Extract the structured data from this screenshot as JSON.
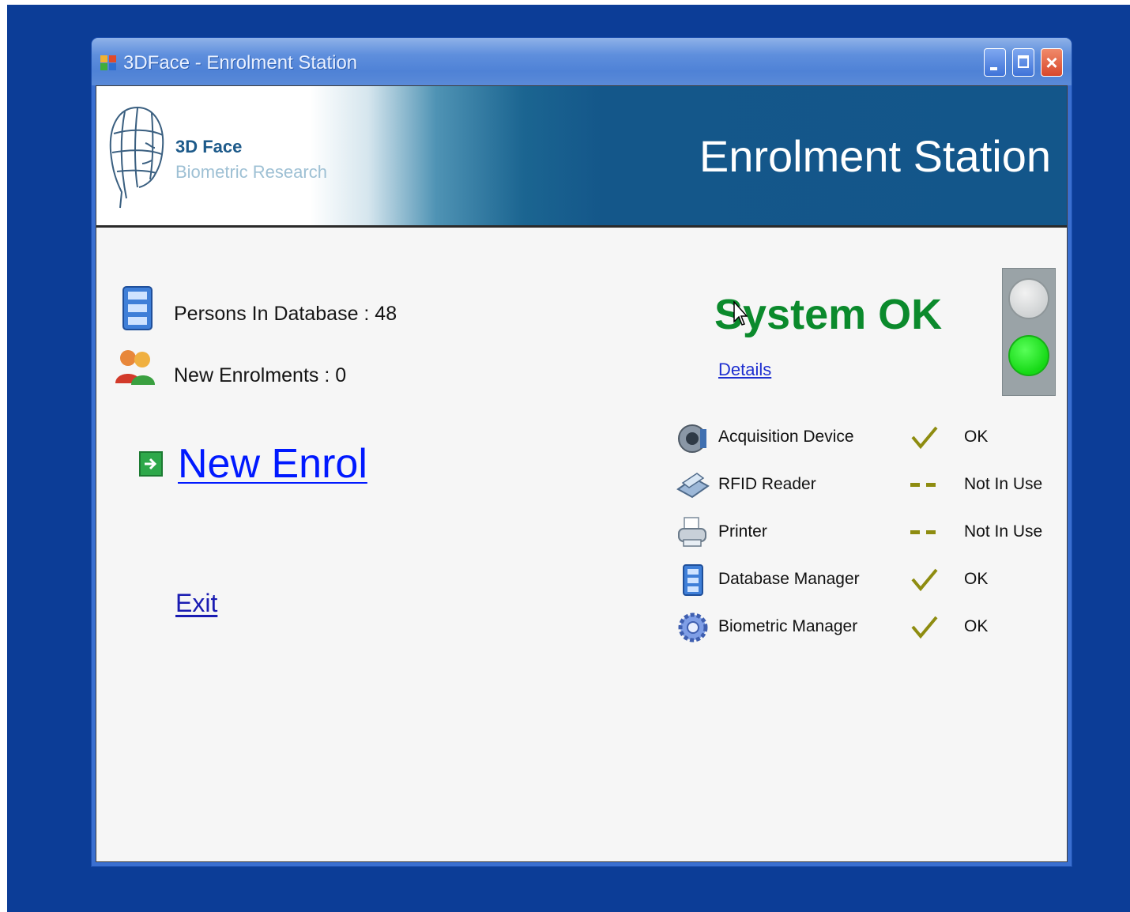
{
  "window": {
    "title": "3DFace - Enrolment Station"
  },
  "banner": {
    "logo_title": "3D Face",
    "logo_subtitle": "Biometric Research",
    "heading": "Enrolment Station"
  },
  "stats": {
    "persons_label": "Persons In Database : 48",
    "enrolments_label": "New Enrolments : 0"
  },
  "actions": {
    "new_enrol": "New Enrol",
    "exit": "Exit"
  },
  "system": {
    "status": "System OK",
    "details_link": "Details",
    "status_color": "#0b8a2c",
    "traffic_light_on": "green"
  },
  "devices": [
    {
      "label": "Acquisition Device",
      "mark": "check",
      "status": "OK",
      "icon": "camera-icon"
    },
    {
      "label": "RFID Reader",
      "mark": "dash",
      "status": "Not In Use",
      "icon": "rfid-reader-icon"
    },
    {
      "label": "Printer",
      "mark": "dash",
      "status": "Not In Use",
      "icon": "printer-icon"
    },
    {
      "label": "Database Manager",
      "mark": "check",
      "status": "OK",
      "icon": "database-icon"
    },
    {
      "label": "Biometric Manager",
      "mark": "check",
      "status": "OK",
      "icon": "gear-icon"
    }
  ],
  "colors": {
    "desktop": "#0c3d97",
    "link": "#0019ff",
    "mark": "#8e8c10"
  }
}
